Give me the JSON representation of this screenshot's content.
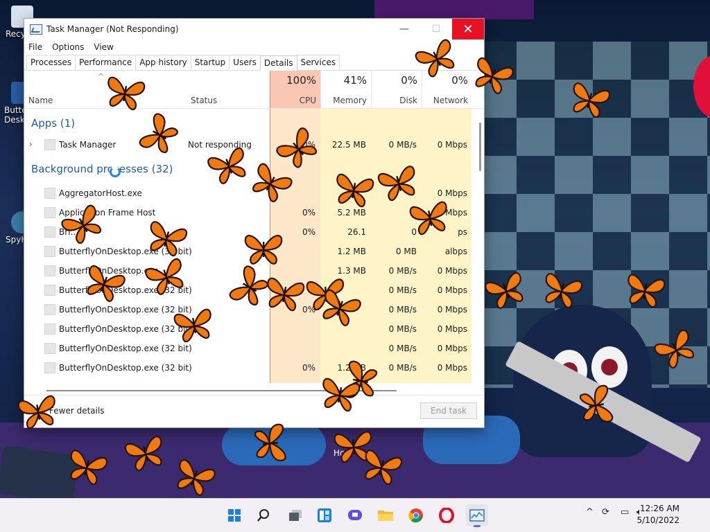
{
  "window": {
    "title": "Task Manager (Not Responding)",
    "minimize_glyph": "—",
    "maximize_glyph": "☐",
    "close_glyph": "✕"
  },
  "menu": [
    "File",
    "Options",
    "View"
  ],
  "tabs": [
    "Processes",
    "Performance",
    "App history",
    "Startup",
    "Users",
    "Details",
    "Services"
  ],
  "active_tab": "Details",
  "columns": {
    "name": "Name",
    "status": "Status",
    "cpu": {
      "pct": "100%",
      "label": "CPU"
    },
    "memory": {
      "pct": "41%",
      "label": "Memory"
    },
    "disk": {
      "pct": "0%",
      "label": "Disk"
    },
    "network": {
      "pct": "0%",
      "label": "Network"
    }
  },
  "groups": {
    "apps": "Apps (1)",
    "background": "Background processes (32)"
  },
  "apps": [
    {
      "name": "Task Manager",
      "status": "Not responding",
      "cpu": "0%",
      "memory": "22.5 MB",
      "disk": "0 MB/s",
      "network": "0 Mbps"
    }
  ],
  "processes": [
    {
      "name": "AggregatorHost.exe",
      "cpu": "",
      "memory": "",
      "disk": "",
      "network": "0 Mbps"
    },
    {
      "name": "Application Frame Host",
      "cpu": "0%",
      "memory": "5.2 MB",
      "disk": "",
      "network": "Mbps"
    },
    {
      "name": "Bri…er",
      "cpu": "0%",
      "memory": "26.1",
      "disk": "0",
      "network": "ps"
    },
    {
      "name": "ButterflyOnDesktop.exe (32 bit)",
      "cpu": "",
      "memory": "1.2 MB",
      "disk": "0 MB",
      "network": "albps"
    },
    {
      "name": "ButterflyOnDesktop.exe",
      "cpu": "",
      "memory": "1.3 MB",
      "disk": "0 MB/s",
      "network": "0 Mbps"
    },
    {
      "name": "ButterflyOnDesktop.exe (32 bit)",
      "cpu": "",
      "memory": "",
      "disk": "0 MB/s",
      "network": "0 Mbps"
    },
    {
      "name": "ButterflyOnDesktop.exe (32 bit)",
      "cpu": "0%",
      "memory": "",
      "disk": "0 MB/s",
      "network": "0 Mbps"
    },
    {
      "name": "ButterflyOnDesktop.exe (32 bit)",
      "cpu": "",
      "memory": "",
      "disk": "0 MB/s",
      "network": "0 Mbps"
    },
    {
      "name": "ButterflyOnDesktop.exe (32 bit)",
      "cpu": "",
      "memory": "",
      "disk": "0 MB/s",
      "network": "0 Mbps"
    },
    {
      "name": "ButterflyOnDesktop.exe (32 bit)",
      "cpu": "0%",
      "memory": "1.2 MB",
      "disk": "0 MB/s",
      "network": "0 Mbps"
    }
  ],
  "footer": {
    "fewer_details": "Fewer details",
    "end_task": "End task"
  },
  "desktop_icons": [
    "Recy",
    "Butte Desk",
    "SpyH"
  ],
  "wallpaper_text": "Hor",
  "taskbar": {
    "icons": [
      "windows-start-icon",
      "search-icon",
      "task-view-icon",
      "widgets-icon",
      "chat-icon",
      "file-explorer-icon",
      "chrome-icon",
      "opera-icon",
      "task-manager-icon"
    ],
    "time": "12:26 AM",
    "date": "5/10/2022"
  },
  "colors": {
    "cpu_header": "#f9c7b3",
    "cpu_heat": "#fde7c9",
    "heat": "#fff4c8",
    "group_text": "#1e5aa8",
    "close_button": "#e81123",
    "butterfly_orange": "#f07a12"
  }
}
